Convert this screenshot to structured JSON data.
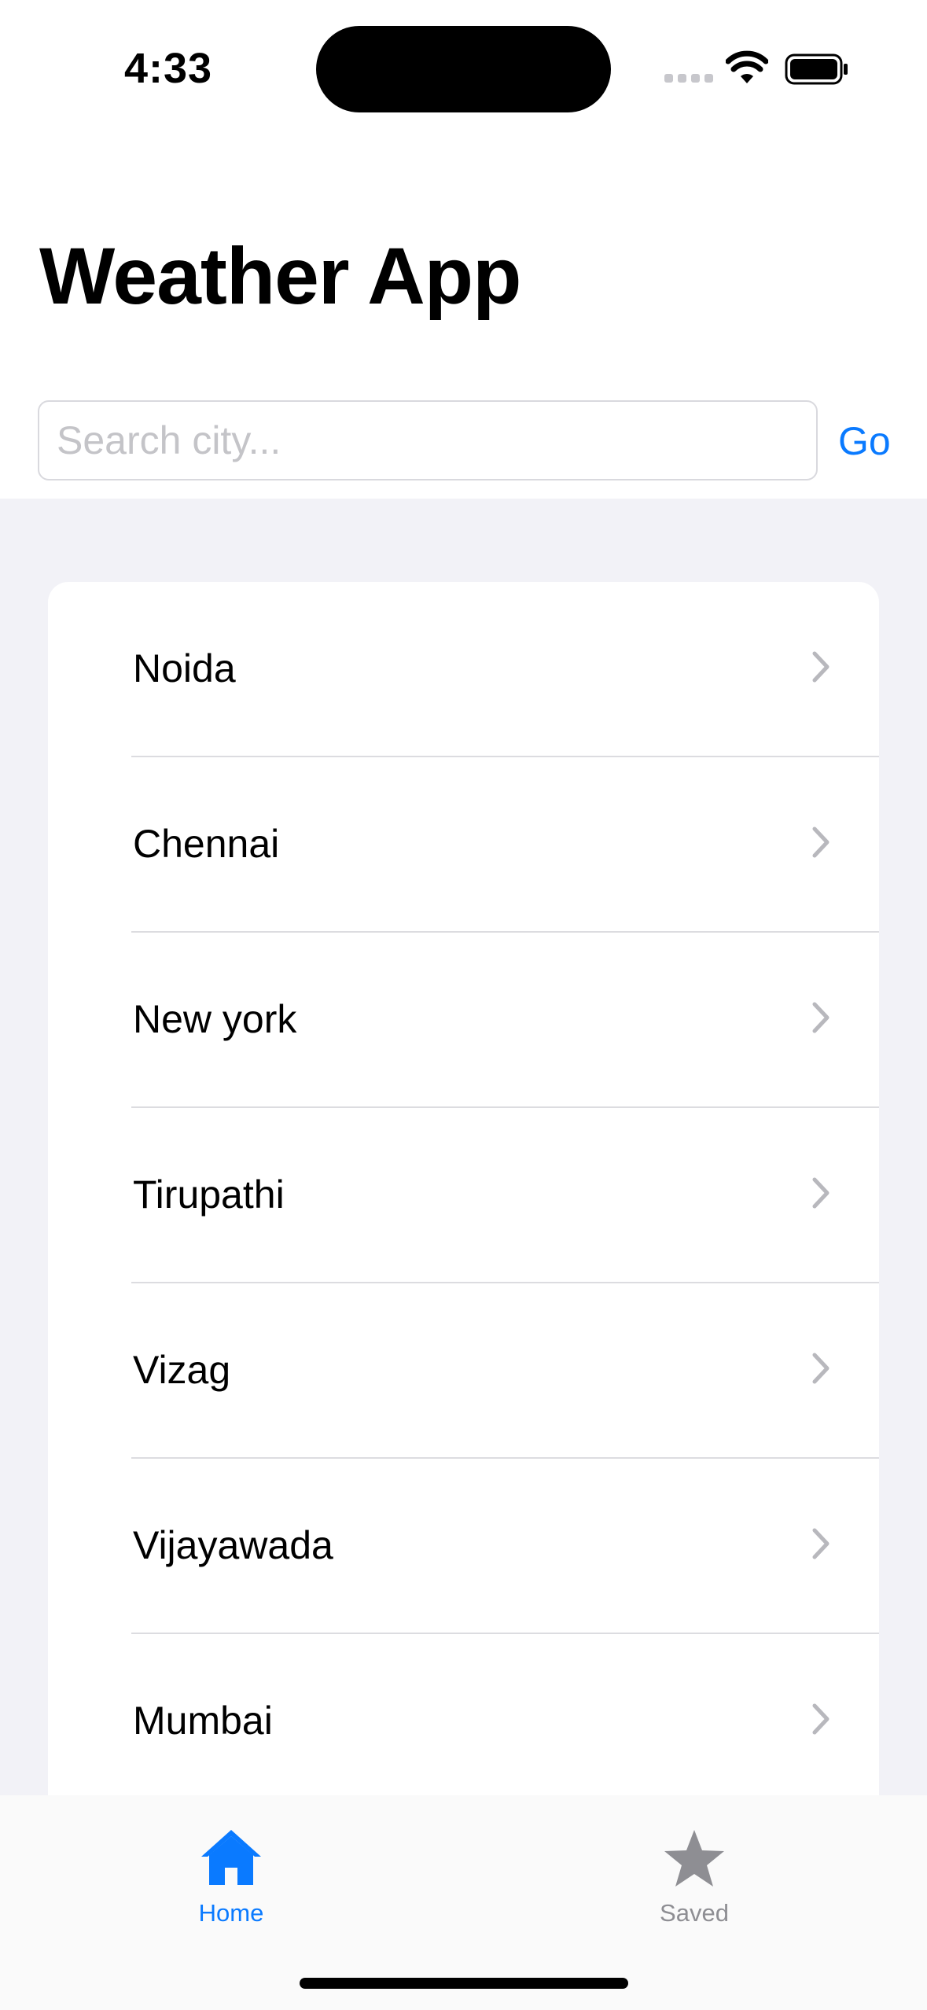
{
  "status_bar": {
    "time": "4:33"
  },
  "header": {
    "title": "Weather App"
  },
  "search": {
    "placeholder": "Search city...",
    "value": "",
    "go_label": "Go"
  },
  "cities": [
    {
      "label": "Noida"
    },
    {
      "label": "Chennai"
    },
    {
      "label": "New york"
    },
    {
      "label": "Tirupathi"
    },
    {
      "label": "Vizag"
    },
    {
      "label": "Vijayawada"
    },
    {
      "label": "Mumbai"
    }
  ],
  "tab_bar": {
    "tabs": [
      {
        "label": "Home",
        "icon": "house-icon",
        "selected": true
      },
      {
        "label": "Saved",
        "icon": "star-icon",
        "selected": false
      }
    ]
  },
  "colors": {
    "accent": "#0a7aff",
    "inactive": "#8e8e93",
    "list_background": "#f2f2f7"
  }
}
